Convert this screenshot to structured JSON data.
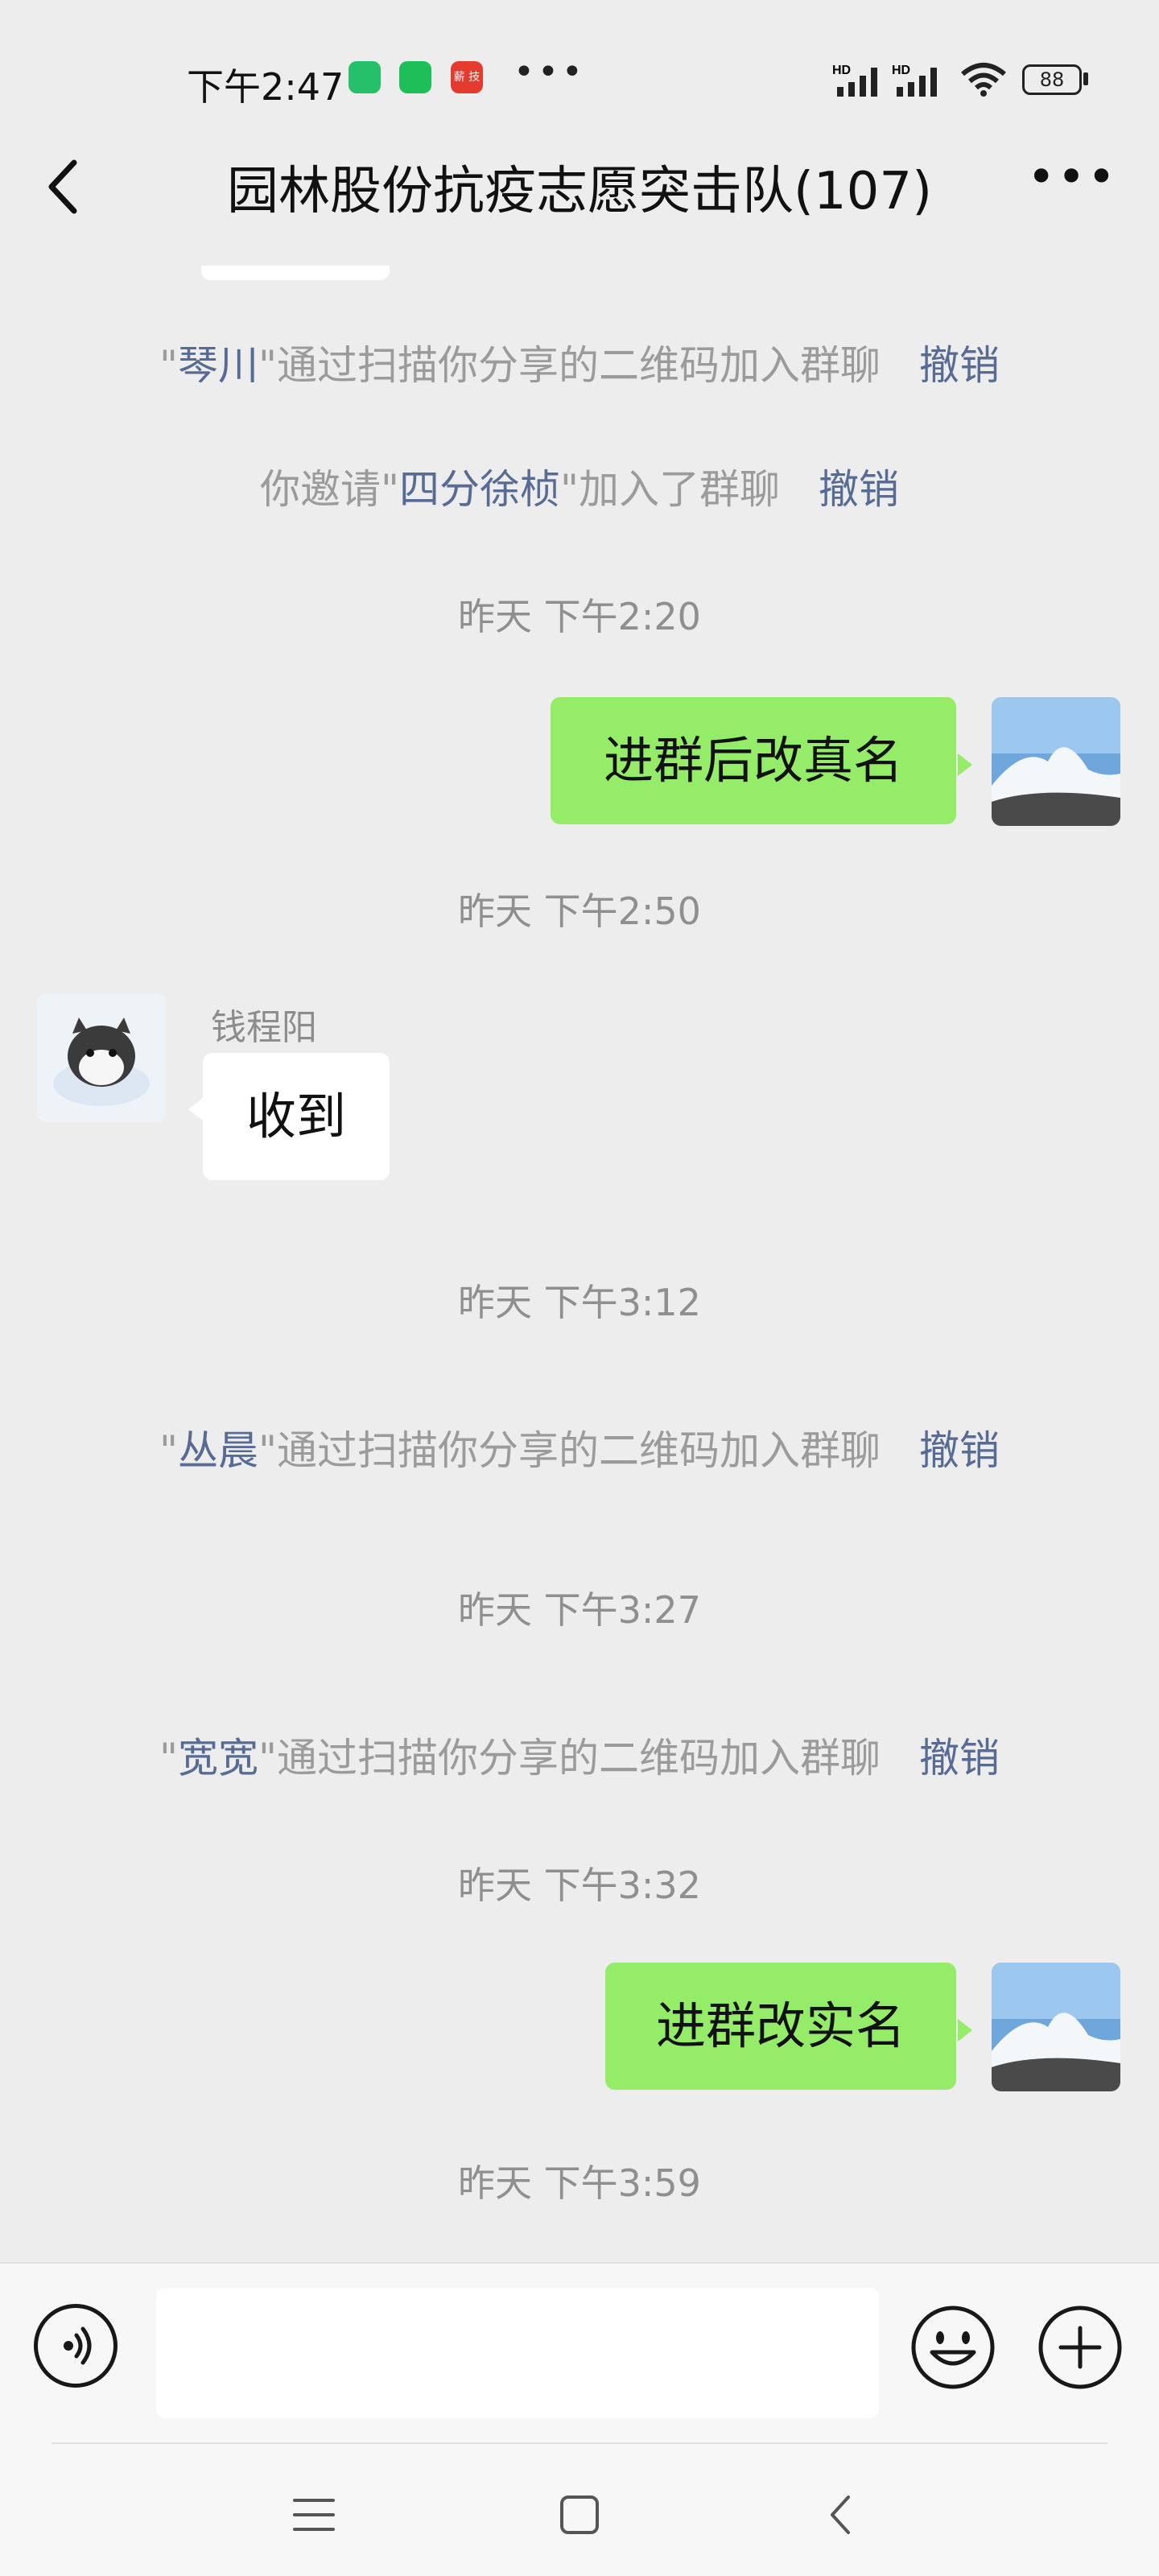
{
  "status": {
    "time": "下午2:47",
    "app_badge": "薪 技",
    "battery": "88"
  },
  "header": {
    "title": "园林股份抗疫志愿突击队(107)"
  },
  "messages": {
    "n1": {
      "q1": "\"",
      "name": "琴川",
      "q2": "\"",
      "text": "通过扫描你分享的二维码加入群聊",
      "revoke": "撤销"
    },
    "n2": {
      "pre": "你邀请\"",
      "name": "四分徐桢",
      "post": "\"加入了群聊",
      "revoke": "撤销"
    },
    "t1": "昨天  下午2:20",
    "m1": "进群后改真名",
    "t2": "昨天  下午2:50",
    "sender": "钱程阳",
    "m2": "收到",
    "t3": "昨天  下午3:12",
    "n3": {
      "q1": "\"",
      "name": "丛晨",
      "q2": "\"",
      "text": "通过扫描你分享的二维码加入群聊",
      "revoke": "撤销"
    },
    "t4": "昨天  下午3:27",
    "n4": {
      "q1": "\"",
      "name": "宽宽",
      "q2": "\"",
      "text": "通过扫描你分享的二维码加入群聊",
      "revoke": "撤销"
    },
    "t5": "昨天  下午3:32",
    "m3": "进群改实名",
    "t6": "昨天  下午3:59"
  },
  "input": {
    "value": "",
    "placeholder": ""
  },
  "icons": {
    "back": "chevron-left-icon",
    "more": "more-icon",
    "voice": "voice-icon",
    "emoji": "emoji-icon",
    "plus": "plus-icon",
    "menu": "menu-icon",
    "home": "home-icon",
    "nav_back": "back-icon"
  },
  "colors": {
    "bubble_me": "#95ec69",
    "link": "#576b95",
    "background": "#ededed"
  }
}
